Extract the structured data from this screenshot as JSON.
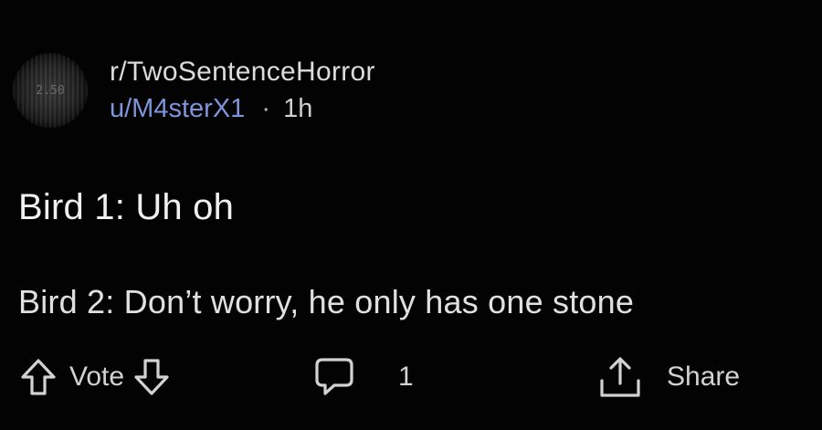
{
  "post": {
    "subreddit": "r/TwoSentenceHorror",
    "username": "u/M4sterX1",
    "separator": "·",
    "time": "1h",
    "avatar_text": "2.50",
    "title": "Bird 1: Uh oh",
    "body": "Bird 2: Don’t worry, he only has one stone"
  },
  "actions": {
    "vote_label": "Vote",
    "comment_count": "1",
    "share_label": "Share"
  },
  "icons": {
    "upvote": "arrow-up-outline-icon",
    "downvote": "arrow-down-outline-icon",
    "comment": "speech-bubble-icon",
    "share": "share-upload-icon"
  },
  "colors": {
    "background": "#030303",
    "username": "#7f95d9",
    "text": "#e0e0e0"
  }
}
